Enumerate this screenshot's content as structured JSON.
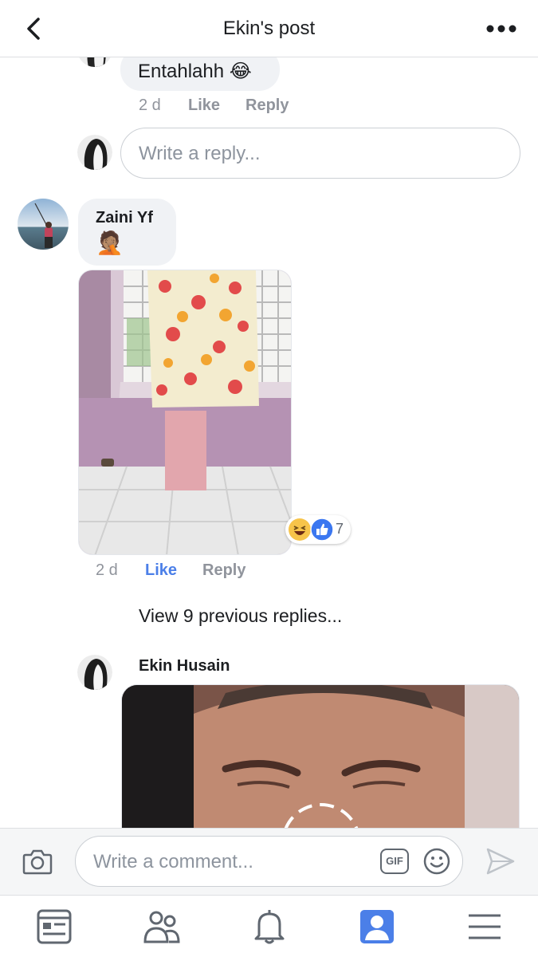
{
  "header": {
    "title": "Ekin's post",
    "back_icon": "chevron-left-icon",
    "more_icon": "more-dots-icon"
  },
  "thread": {
    "top_comment": {
      "text": "Entahlahh 😂",
      "time": "2 d",
      "like_label": "Like",
      "reply_label": "Reply"
    },
    "reply_input": {
      "placeholder": "Write a reply..."
    },
    "comment_zaini": {
      "author": "Zaini Yf",
      "emoji": "🤦🏽",
      "time": "2 d",
      "like_label": "Like",
      "reply_label": "Reply",
      "reactions": {
        "icons": [
          "haha-icon",
          "like-icon"
        ],
        "count": "7"
      }
    },
    "view_previous": "View 9 previous replies...",
    "comment_ekin": {
      "author": "Ekin Husain"
    }
  },
  "composer": {
    "placeholder": "Write a comment...",
    "gif_label": "GIF"
  },
  "tabbar": {
    "items": [
      "news-feed-icon",
      "friends-icon",
      "notifications-icon",
      "profile-icon",
      "menu-icon"
    ],
    "active": "profile-icon"
  },
  "colors": {
    "accent": "#4b7fe8",
    "bubble": "#f0f2f5",
    "meta": "#90949c"
  }
}
